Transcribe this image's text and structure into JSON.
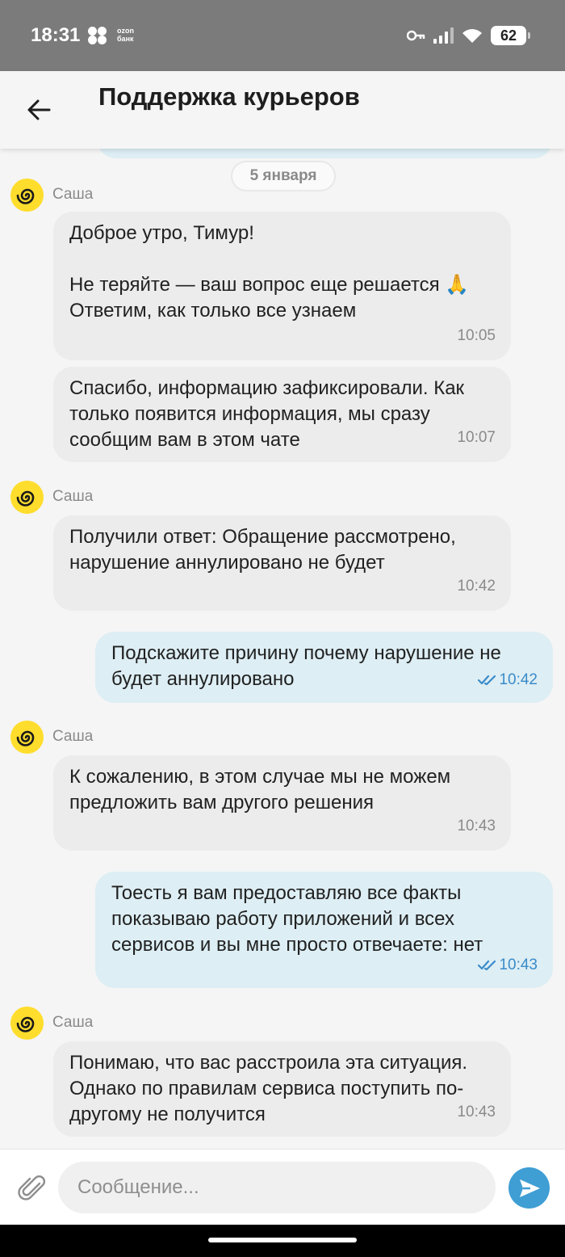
{
  "status_bar": {
    "time": "18:31",
    "app_label": "ozon\nбанк",
    "battery": "62"
  },
  "header": {
    "title": "Поддержка курьеров",
    "back_icon": "arrow-left-icon"
  },
  "chat": {
    "date_divider": "5 января",
    "sender": "Саша",
    "messages": [
      {
        "direction": "in",
        "text": "Доброе утро, Тимур!\n\nНе теряйте — ваш вопрос еще решается 🙏\nОтветим, как только все узнаем",
        "time": "10:05"
      },
      {
        "direction": "in",
        "text": "Спасибо, информацию зафиксировали. Как только появится информация, мы сразу сообщим вам в этом чате",
        "time": "10:07"
      },
      {
        "direction": "in",
        "text": "Получили ответ: Обращение рассмотрено, нарушение аннулировано не будет",
        "time": "10:42"
      },
      {
        "direction": "out",
        "text": "Подскажите причину почему нарушение не будет аннулировано",
        "time": "10:42",
        "status": "read"
      },
      {
        "direction": "in",
        "text": "К сожалению, в этом случае мы не можем предложить вам другого решения",
        "time": "10:43"
      },
      {
        "direction": "out",
        "text": "Тоесть я вам предоставляю все факты показываю работу приложений и всех сервисов и вы мне просто отвечаете: нет",
        "time": "10:43",
        "status": "read"
      },
      {
        "direction": "in",
        "text": "Понимаю, что вас расстроила эта ситуация. Однако по правилам сервиса поступить по-другому не получится",
        "time": "10:43"
      }
    ]
  },
  "composer": {
    "placeholder": "Сообщение...",
    "attach_icon": "paperclip-icon",
    "send_icon": "send-icon"
  },
  "colors": {
    "incoming_bubble": "#ececec",
    "outgoing_bubble": "#ddeef4",
    "read_check": "#3a8bc9",
    "avatar": "#ffdd2d",
    "send_button": "#3f9ed4"
  }
}
